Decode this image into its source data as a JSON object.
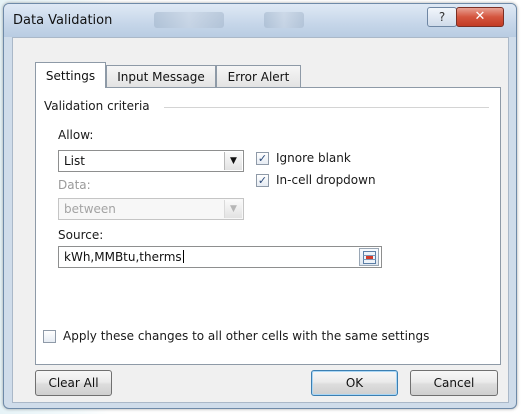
{
  "dialog": {
    "title": "Data Validation",
    "help_glyph": "?",
    "close_glyph": "✕"
  },
  "tabs": [
    {
      "label": "Settings",
      "active": true
    },
    {
      "label": "Input Message",
      "active": false
    },
    {
      "label": "Error Alert",
      "active": false
    }
  ],
  "settings": {
    "group_label": "Validation criteria",
    "allow_label": "Allow:",
    "allow_value": "List",
    "data_label": "Data:",
    "data_value": "between",
    "ignore_blank_label": "Ignore blank",
    "ignore_blank_checked": true,
    "in_cell_dropdown_label": "In-cell dropdown",
    "in_cell_dropdown_checked": true,
    "source_label": "Source:",
    "source_value": "kWh,MMBtu,therms"
  },
  "apply_all": {
    "label": "Apply these changes to all other cells with the same settings",
    "checked": false
  },
  "buttons": {
    "clear_all": "Clear All",
    "ok": "OK",
    "cancel": "Cancel"
  },
  "icons": {
    "dropdown_arrow": "chevron-down-icon",
    "range_selector": "range-select-icon",
    "check": "checkmark-icon"
  },
  "colors": {
    "title_bar": "#c6d6e9",
    "close_button": "#c94a33",
    "dialog_body": "#f0f0f0"
  }
}
